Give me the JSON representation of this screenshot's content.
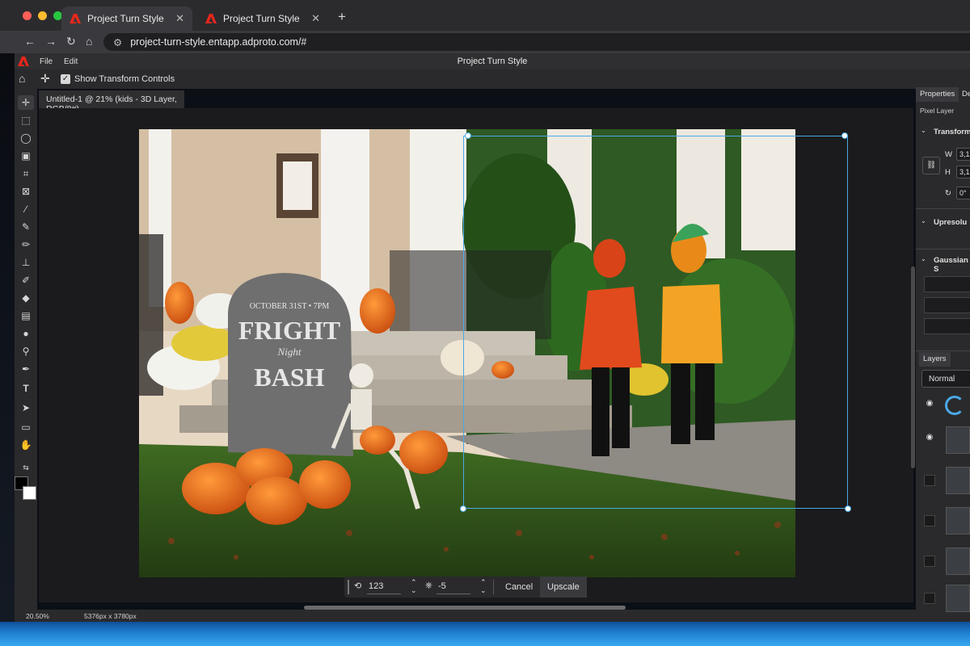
{
  "browser": {
    "tabs": [
      {
        "title": "Project Turn Style",
        "active": true
      },
      {
        "title": "Project Turn Style",
        "active": false
      }
    ],
    "url": "project-turn-style.entapp.adproto.com/#"
  },
  "app": {
    "menu": [
      "File",
      "Edit"
    ],
    "title": "Project Turn Style"
  },
  "options": {
    "show_transform_label": "Show Transform Controls",
    "show_transform_checked": true
  },
  "document": {
    "tab_title": "Untitled-1 @ 21% (kids - 3D Layer, RGB/8#)"
  },
  "context_bar": {
    "rotation_value": "123",
    "tilt_value": "-5",
    "cancel_label": "Cancel",
    "upscale_label": "Upscale"
  },
  "status": {
    "zoom": "20.50%",
    "dimensions": "5376px x 3780px"
  },
  "properties": {
    "tabs": [
      "Properties",
      "De"
    ],
    "layer_type": "Pixel Layer",
    "transform_heading": "Transform",
    "w_label": "W",
    "h_label": "H",
    "w_value": "3,1",
    "h_value": "3,1",
    "angle_value": "0°",
    "upres_heading": "Upresolu",
    "gaussian_heading": "Gaussian S"
  },
  "layers": {
    "tab": "Layers",
    "blend_mode": "Normal"
  },
  "icons": {
    "app_logo": "adobe-logo-icon",
    "accent": "#4aa9e6",
    "brand_red": "#e8271c"
  }
}
